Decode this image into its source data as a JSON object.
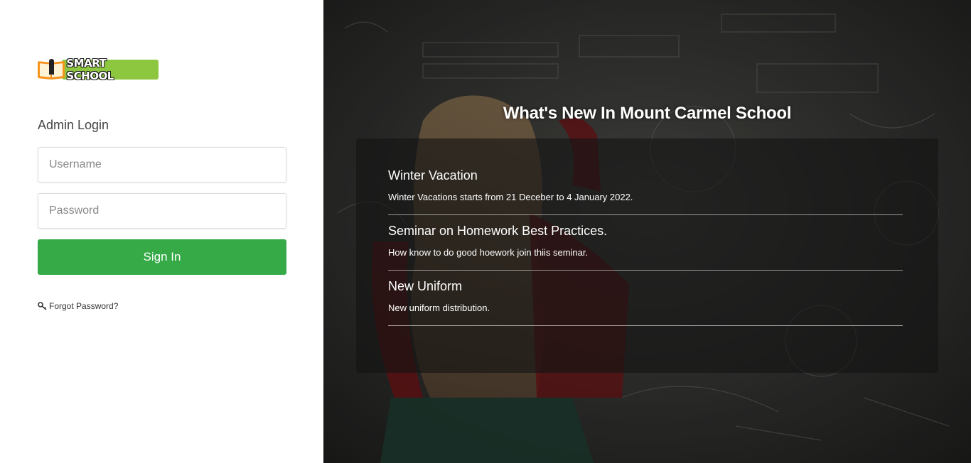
{
  "logo": {
    "text": "SMART SCHOOL"
  },
  "login": {
    "title": "Admin Login",
    "username_placeholder": "Username",
    "password_placeholder": "Password",
    "signin_label": "Sign In",
    "forgot_label": "Forgot Password?"
  },
  "news": {
    "heading": "What's New In Mount Carmel School",
    "items": [
      {
        "title": "Winter Vacation",
        "description": "Winter Vacations starts from 21 Deceber to 4 January 2022."
      },
      {
        "title": "Seminar on Homework Best Practices.",
        "description": "How know to do good hoework join thiis seminar."
      },
      {
        "title": "New Uniform",
        "description": "New uniform distribution."
      }
    ]
  },
  "colors": {
    "accent_green": "#35aa47",
    "logo_green": "#8dc63f",
    "logo_orange": "#f7941d"
  },
  "icons": {
    "forgot": "key-icon",
    "logo": "book-pen-icon"
  }
}
